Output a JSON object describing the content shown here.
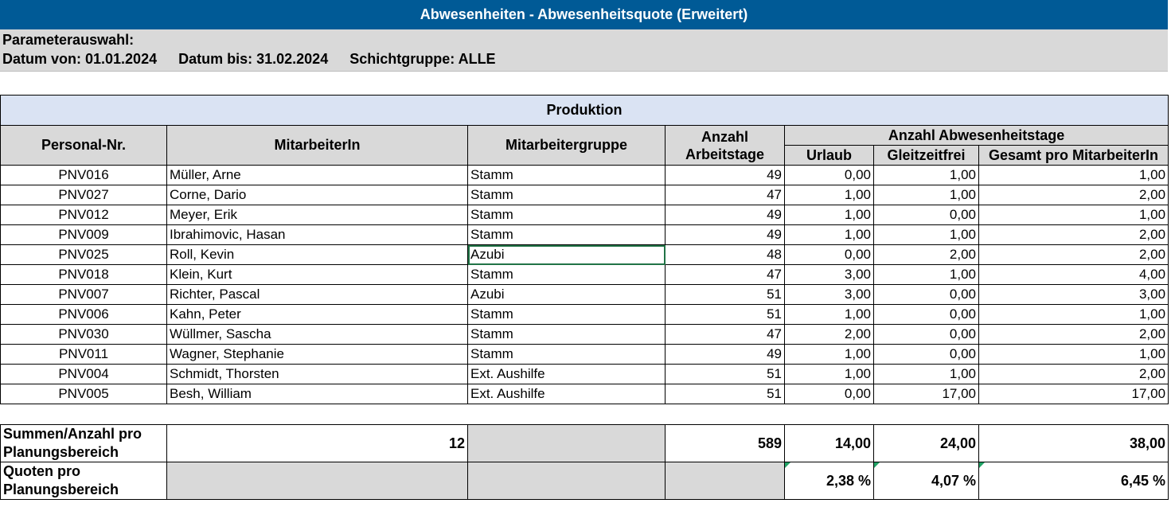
{
  "title": "Abwesenheiten - Abwesenheitsquote (Erweitert)",
  "params": {
    "heading": "Parameterauswahl:",
    "date_from": "Datum von: 01.01.2024",
    "date_to": "Datum bis: 31.02.2024",
    "shift_group": "Schichtgruppe: ALLE"
  },
  "section": "Produktion",
  "headers": {
    "personal_nr": "Personal-Nr.",
    "employee": "MitarbeiterIn",
    "group": "Mitarbeitergruppe",
    "workdays_1": "Anzahl",
    "workdays_2": "Arbeitstage",
    "absence_days": "Anzahl Abwesenheitstage",
    "vacation": "Urlaub",
    "flextime": "Gleitzeitfrei",
    "total": "Gesamt pro MitarbeiterIn"
  },
  "rows": [
    {
      "nr": "PNV016",
      "name": "Müller, Arne",
      "group": "Stamm",
      "days": "49",
      "vacation": "0,00",
      "flex": "1,00",
      "total": "1,00"
    },
    {
      "nr": "PNV027",
      "name": "Corne, Dario",
      "group": "Stamm",
      "days": "47",
      "vacation": "1,00",
      "flex": "1,00",
      "total": "2,00"
    },
    {
      "nr": "PNV012",
      "name": "Meyer, Erik",
      "group": "Stamm",
      "days": "49",
      "vacation": "1,00",
      "flex": "0,00",
      "total": "1,00"
    },
    {
      "nr": "PNV009",
      "name": "Ibrahimovic, Hasan",
      "group": "Stamm",
      "days": "49",
      "vacation": "1,00",
      "flex": "1,00",
      "total": "2,00"
    },
    {
      "nr": "PNV025",
      "name": "Roll, Kevin",
      "group": "Azubi",
      "days": "48",
      "vacation": "0,00",
      "flex": "2,00",
      "total": "2,00"
    },
    {
      "nr": "PNV018",
      "name": "Klein, Kurt",
      "group": "Stamm",
      "days": "47",
      "vacation": "3,00",
      "flex": "1,00",
      "total": "4,00"
    },
    {
      "nr": "PNV007",
      "name": "Richter, Pascal",
      "group": "Azubi",
      "days": "51",
      "vacation": "3,00",
      "flex": "0,00",
      "total": "3,00"
    },
    {
      "nr": "PNV006",
      "name": "Kahn, Peter",
      "group": "Stamm",
      "days": "51",
      "vacation": "1,00",
      "flex": "0,00",
      "total": "1,00"
    },
    {
      "nr": "PNV030",
      "name": "Wüllmer, Sascha",
      "group": "Stamm",
      "days": "47",
      "vacation": "2,00",
      "flex": "0,00",
      "total": "2,00"
    },
    {
      "nr": "PNV011",
      "name": "Wagner, Stephanie",
      "group": "Stamm",
      "days": "49",
      "vacation": "1,00",
      "flex": "0,00",
      "total": "1,00"
    },
    {
      "nr": "PNV004",
      "name": "Schmidt, Thorsten",
      "group": "Ext. Aushilfe",
      "days": "51",
      "vacation": "1,00",
      "flex": "1,00",
      "total": "2,00"
    },
    {
      "nr": "PNV005",
      "name": "Besh, William",
      "group": "Ext. Aushilfe",
      "days": "51",
      "vacation": "0,00",
      "flex": "17,00",
      "total": "17,00"
    }
  ],
  "summary": {
    "label": "Summen/Anzahl pro Planungsbereich",
    "count": "12",
    "days": "589",
    "vacation": "14,00",
    "flex": "24,00",
    "total": "38,00"
  },
  "quota": {
    "label": "Quoten pro Planungsbereich",
    "vacation": "2,38 %",
    "flex": "4,07 %",
    "total": "6,45 %"
  },
  "colors": {
    "title_bg": "#005a96",
    "section_bg": "#dae3f3",
    "header_bg": "#d9d9d9",
    "selection": "#217346"
  }
}
